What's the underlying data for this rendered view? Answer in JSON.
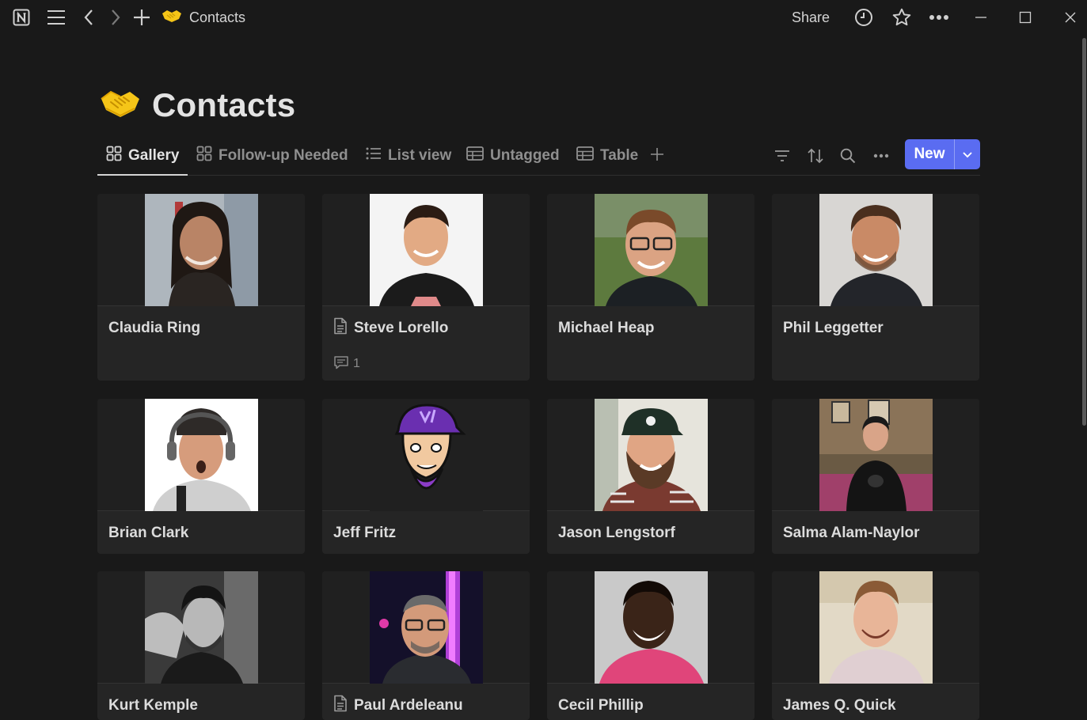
{
  "titlebar": {
    "breadcrumb_title": "Contacts",
    "share_label": "Share",
    "icons": [
      "notion-logo-icon",
      "menu-icon",
      "back-arrow-icon",
      "forward-arrow-icon",
      "plus-icon",
      "handshake-icon",
      "history-clock-icon",
      "star-icon",
      "more-icon",
      "minimize-icon",
      "maximize-icon",
      "close-icon"
    ]
  },
  "page": {
    "title": "Contacts",
    "icon": "handshake-icon"
  },
  "views": {
    "tabs": [
      {
        "label": "Gallery",
        "icon": "gallery-icon",
        "active": true
      },
      {
        "label": "Follow-up Needed",
        "icon": "gallery-icon",
        "active": false
      },
      {
        "label": "List view",
        "icon": "list-icon",
        "active": false
      },
      {
        "label": "Untagged",
        "icon": "table-icon",
        "active": false
      },
      {
        "label": "Table",
        "icon": "table-icon",
        "active": false
      }
    ],
    "new_label": "New"
  },
  "colors": {
    "background": "#191919",
    "card": "#252525",
    "accent": "#5a6cf1",
    "handshake": "#f5c518"
  },
  "cards": [
    {
      "name": "Claudia Ring",
      "has_page_icon": false,
      "comments": ""
    },
    {
      "name": "Steve Lorello",
      "has_page_icon": true,
      "comments": "1"
    },
    {
      "name": "Michael Heap",
      "has_page_icon": false,
      "comments": ""
    },
    {
      "name": "Phil Leggetter",
      "has_page_icon": false,
      "comments": ""
    },
    {
      "name": "Brian Clark",
      "has_page_icon": false,
      "comments": ""
    },
    {
      "name": "Jeff Fritz",
      "has_page_icon": false,
      "comments": ""
    },
    {
      "name": "Jason Lengstorf",
      "has_page_icon": false,
      "comments": ""
    },
    {
      "name": "Salma Alam-Naylor",
      "has_page_icon": false,
      "comments": ""
    },
    {
      "name": "Kurt Kemple",
      "has_page_icon": false,
      "comments": ""
    },
    {
      "name": "Paul Ardeleanu",
      "has_page_icon": true,
      "comments": ""
    },
    {
      "name": "Cecil Phillip",
      "has_page_icon": false,
      "comments": ""
    },
    {
      "name": "James Q. Quick",
      "has_page_icon": false,
      "comments": ""
    }
  ]
}
